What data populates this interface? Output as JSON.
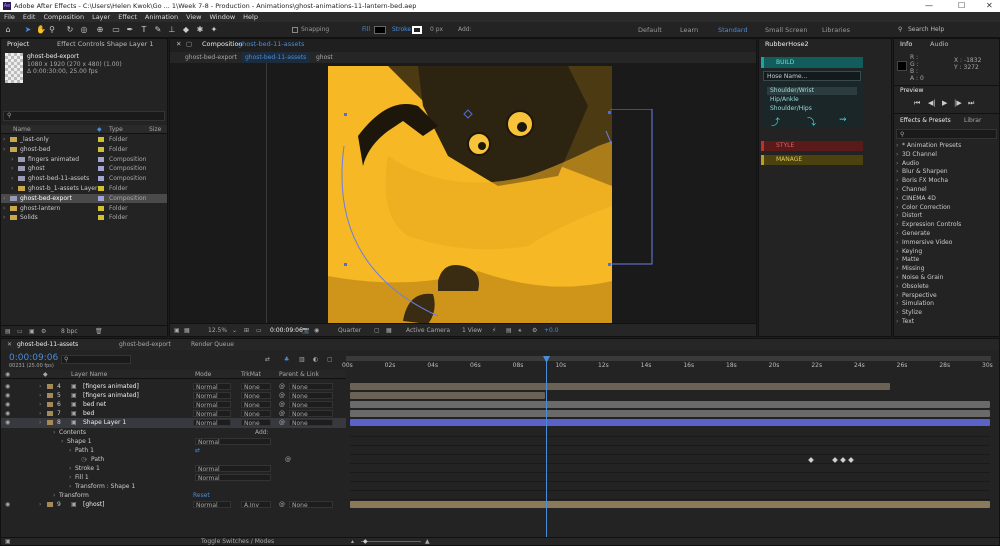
{
  "titlebar": {
    "title": "Adobe After Effects - C:\\Users\\Helen Kwok\\Go ...  1\\Week 7-8 - Production - Animations\\ghost-animations-11-lantern-bed.aep",
    "minimize": "—",
    "maximize": "☐",
    "close": "✕"
  },
  "menu": [
    "File",
    "Edit",
    "Composition",
    "Layer",
    "Effect",
    "Animation",
    "View",
    "Window",
    "Help"
  ],
  "toolbar": {
    "snapping": "Snapping",
    "fill": "Fill",
    "stroke": "Stroke",
    "px": "0 px",
    "add": "Add:",
    "workspaces": [
      "Default",
      "Learn",
      "Standard",
      "Small Screen",
      "Libraries"
    ],
    "search": "Search Help"
  },
  "project": {
    "tab": "Project",
    "effects_tab": "Effect Controls Shape Layer 1",
    "item_name": "ghost-bed-export",
    "item_info1": "1080 x 1920 (270 x 480) (1.00)",
    "item_info2": "Δ 0:00:30:00, 25.00 fps",
    "columns": [
      "Name",
      "Type",
      "Size"
    ],
    "items": [
      {
        "name": "_last-only",
        "type": "Folder",
        "color": "#d2c12c",
        "indent": 0
      },
      {
        "name": "ghost-bed",
        "type": "Folder",
        "color": "#d2c12c",
        "indent": 0
      },
      {
        "name": "fingers animated",
        "type": "Composition",
        "color": "#a3a3d6",
        "indent": 1
      },
      {
        "name": "ghost",
        "type": "Composition",
        "color": "#a3a3d6",
        "indent": 1
      },
      {
        "name": "ghost-bed-11-assets",
        "type": "Composition",
        "color": "#a3a3d6",
        "indent": 1
      },
      {
        "name": "ghost-b_1-assets Layers",
        "type": "Folder",
        "color": "#d2c12c",
        "indent": 1
      },
      {
        "name": "ghost-bed-export",
        "type": "Composition",
        "color": "#a3a3d6",
        "indent": 0,
        "sel": true
      },
      {
        "name": "ghost-lantern",
        "type": "Folder",
        "color": "#d2c12c",
        "indent": 0
      },
      {
        "name": "Solids",
        "type": "Folder",
        "color": "#d2c12c",
        "indent": 0
      }
    ],
    "bpc": "8 bpc"
  },
  "comp": {
    "tab": "Composition",
    "tab_name": "ghost-bed-11-assets",
    "subtabs": [
      "ghost-bed-export",
      "ghost-bed-11-assets",
      "ghost"
    ],
    "zoom": "12.5%",
    "timecode": "0:00:09:06",
    "quality": "Quarter",
    "camera": "Active Camera",
    "view": "1 View",
    "exposure": "+0.0"
  },
  "rubberhose": {
    "tab": "RubberHose2",
    "build": "BUILD",
    "hose_name": "Hose Name...",
    "options": [
      "Shoulder/Wrist",
      "Hip/Ankle",
      "Shoulder/Hips"
    ],
    "style": "STYLE",
    "manage": "MANAGE"
  },
  "info": {
    "tab": "Info",
    "audio": "Audio",
    "r": "R :",
    "g": "G :",
    "b": "B :",
    "a": "A : 0",
    "x": "X : -1832",
    "y": "Y : 3272"
  },
  "preview": {
    "tab": "Preview"
  },
  "effects": {
    "tab": "Effects & Presets",
    "libr": "Librar",
    "items": [
      "* Animation Presets",
      "3D Channel",
      "Audio",
      "Blur & Sharpen",
      "Boris FX Mocha",
      "Channel",
      "CINEMA 4D",
      "Color Correction",
      "Distort",
      "Expression Controls",
      "Generate",
      "Immersive Video",
      "Keying",
      "Matte",
      "Missing",
      "Noise & Grain",
      "Obsolete",
      "Perspective",
      "Simulation",
      "Stylize",
      "Text"
    ]
  },
  "timeline": {
    "tabs": [
      "ghost-bed-11-assets",
      "ghost-bed-export",
      "Render Queue"
    ],
    "timecode": "0:00:09:06",
    "frames": "00231 (25.00 fps)",
    "headers": {
      "layer_name": "Layer Name",
      "mode": "Mode",
      "trkmat": "TrkMat",
      "parent": "Parent & Link"
    },
    "ruler": [
      "00s",
      "02s",
      "04s",
      "06s",
      "08s",
      "10s",
      "12s",
      "14s",
      "16s",
      "18s",
      "20s",
      "22s",
      "24s",
      "26s",
      "28s",
      "30s"
    ],
    "layers": [
      {
        "num": "4",
        "name": "[fingers animated]",
        "mode": "Normal",
        "trk": "None",
        "parent": "None"
      },
      {
        "num": "5",
        "name": "[fingers animated]",
        "mode": "Normal",
        "trk": "None",
        "parent": "None"
      },
      {
        "num": "6",
        "name": "bed net",
        "mode": "Normal",
        "trk": "None",
        "parent": "None"
      },
      {
        "num": "7",
        "name": "bed",
        "mode": "Normal",
        "trk": "None",
        "parent": "None"
      },
      {
        "num": "8",
        "name": "Shape Layer 1",
        "mode": "Normal",
        "trk": "None",
        "parent": "None"
      }
    ],
    "props": {
      "contents": "Contents",
      "add": "Add:",
      "shape1": "Shape 1",
      "shape_mode": "Normal",
      "path1": "Path 1",
      "path": "Path",
      "stroke": "Stroke 1",
      "stroke_mode": "Normal",
      "fill": "Fill 1",
      "fill_mode": "Normal",
      "transform_shape": "Transform : Shape 1",
      "transform": "Transform",
      "reset": "Reset"
    },
    "layer9": {
      "num": "9",
      "name": "[ghost]",
      "mode": "Normal",
      "trk": "A.Inv",
      "parent": "None"
    },
    "toggle": "Toggle Switches / Modes"
  },
  "colors": {
    "accent": "#2f7ed8",
    "comp_bg": "#f6b824",
    "label_yellow": "#d2c12c",
    "label_lavender": "#a3a3d6",
    "layer_bar": "#6a6a6a",
    "shape_bar": "#5a62c9",
    "ghost_bar": "#8a7a5a"
  }
}
